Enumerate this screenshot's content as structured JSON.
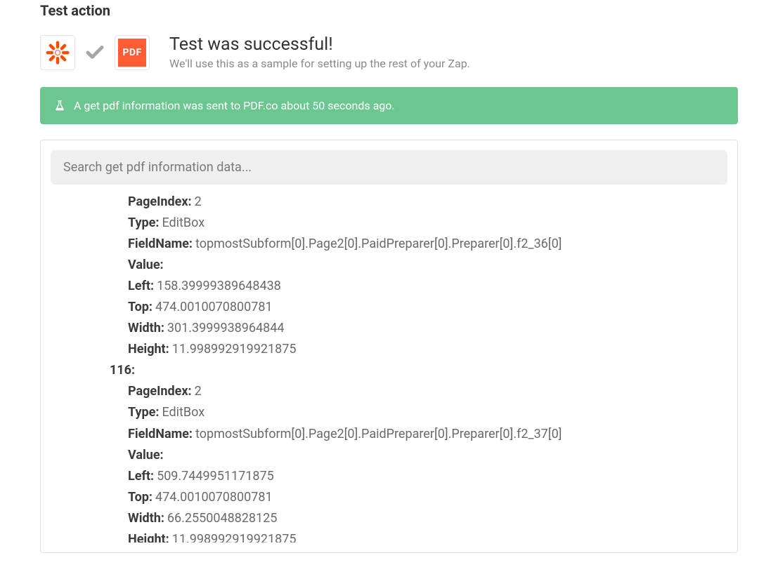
{
  "section_title": "Test action",
  "header": {
    "success_title": "Test was successful!",
    "success_subtitle": "We'll use this as a sample for setting up the rest of your Zap."
  },
  "alert": {
    "text": "A get pdf information was sent to PDF.co about 50 seconds ago."
  },
  "search": {
    "placeholder": "Search get pdf information data..."
  },
  "results": {
    "group_a": {
      "fields": [
        {
          "key": "PageIndex:",
          "val": "2"
        },
        {
          "key": "Type:",
          "val": "EditBox"
        },
        {
          "key": "FieldName:",
          "val": "topmostSubform[0].Page2[0].PaidPreparer[0].Preparer[0].f2_36[0]"
        },
        {
          "key": "Value:",
          "val": ""
        },
        {
          "key": "Left:",
          "val": "158.39999389648438"
        },
        {
          "key": "Top:",
          "val": "474.0010070800781"
        },
        {
          "key": "Width:",
          "val": "301.3999938964844"
        },
        {
          "key": "Height:",
          "val": "11.998992919921875"
        }
      ]
    },
    "group_b_header": "116:",
    "group_b": {
      "fields": [
        {
          "key": "PageIndex:",
          "val": "2"
        },
        {
          "key": "Type:",
          "val": "EditBox"
        },
        {
          "key": "FieldName:",
          "val": "topmostSubform[0].Page2[0].PaidPreparer[0].Preparer[0].f2_37[0]"
        },
        {
          "key": "Value:",
          "val": ""
        },
        {
          "key": "Left:",
          "val": "509.7449951171875"
        },
        {
          "key": "Top:",
          "val": "474.0010070800781"
        },
        {
          "key": "Width:",
          "val": "66.2550048828125"
        },
        {
          "key": "Height:",
          "val": "11.998992919921875"
        }
      ]
    }
  }
}
